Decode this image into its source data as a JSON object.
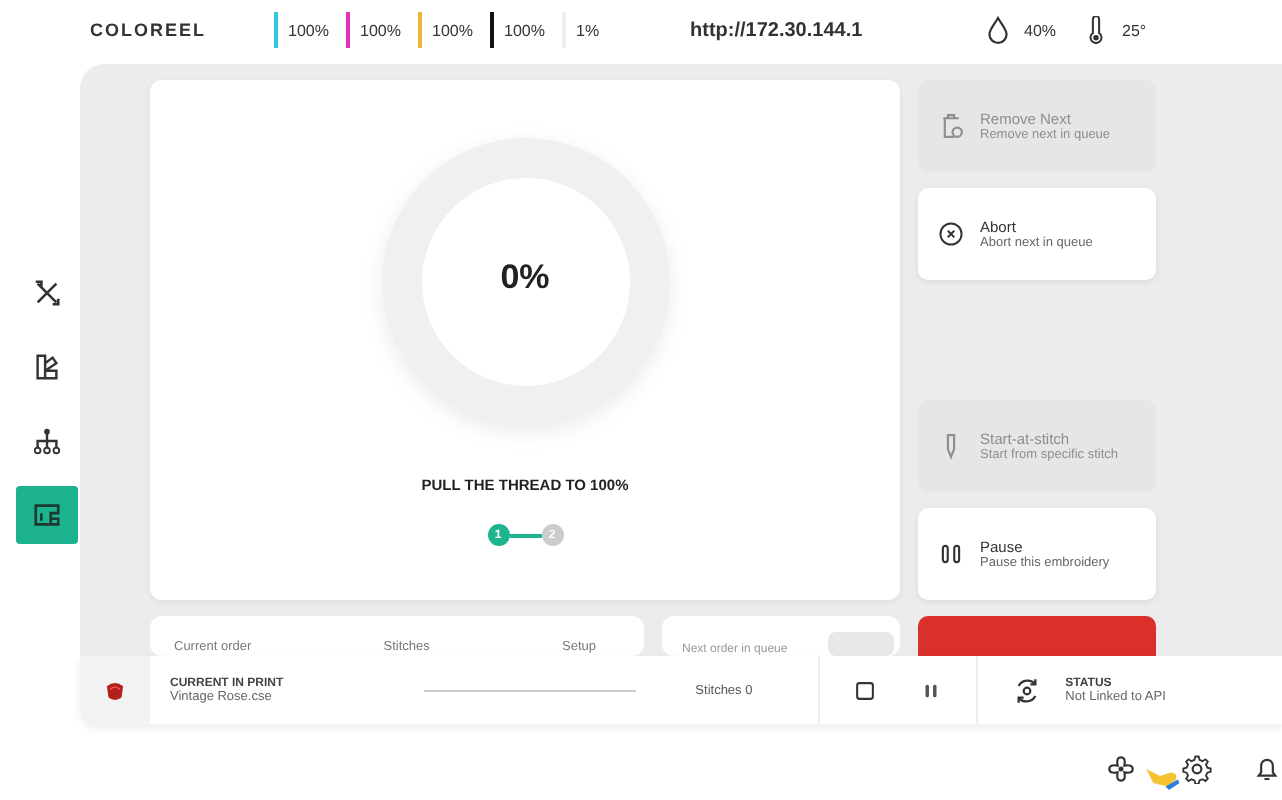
{
  "header": {
    "logo": "COLOREEL",
    "inks": [
      {
        "reading": "100%",
        "color": "#2ec9e0"
      },
      {
        "reading": "100%",
        "color": "#e52fb5"
      },
      {
        "reading": "100%",
        "color": "#f2b233"
      },
      {
        "reading": "100%",
        "color": "#111111"
      },
      {
        "reading": "1%",
        "color": "#eeeeee"
      }
    ],
    "address": "http://172.30.144.1",
    "humidity": "40%",
    "temperature": "25°"
  },
  "sidebar": {
    "items": [
      {
        "kind": "tools",
        "selected": false
      },
      {
        "kind": "palette",
        "selected": false
      },
      {
        "kind": "tree",
        "selected": false
      },
      {
        "kind": "machine",
        "selected": true
      }
    ]
  },
  "progress": {
    "percent": "0%",
    "level": 0,
    "instruction": "PULL THE THREAD TO 100%",
    "steps": [
      {
        "label": "1",
        "selected": true
      },
      {
        "label": "2",
        "selected": false
      }
    ]
  },
  "actions": [
    {
      "kind": "remove",
      "title": "Remove Next",
      "subtitle": "Remove next in queue",
      "disabled": true
    },
    {
      "kind": "abort",
      "title": "Abort",
      "subtitle": "Abort next in queue",
      "disabled": false
    },
    {
      "kind": "start",
      "title": "Start-at-stitch",
      "subtitle": "Start from specific stitch",
      "disabled": true
    },
    {
      "kind": "pause",
      "title": "Pause",
      "subtitle": "Pause this embroidery",
      "disabled": false
    }
  ],
  "current_order": {
    "columns": [
      "Current order",
      "Stitches",
      "Setup"
    ]
  },
  "next_order": {
    "label": "Next order in queue"
  },
  "print_bar": {
    "heading": "CURRENT IN PRINT",
    "file": "Vintage Rose.cse",
    "level": 0,
    "stitches": "Stitches 0",
    "status_heading": "STATUS",
    "status": "Not Linked to API"
  }
}
